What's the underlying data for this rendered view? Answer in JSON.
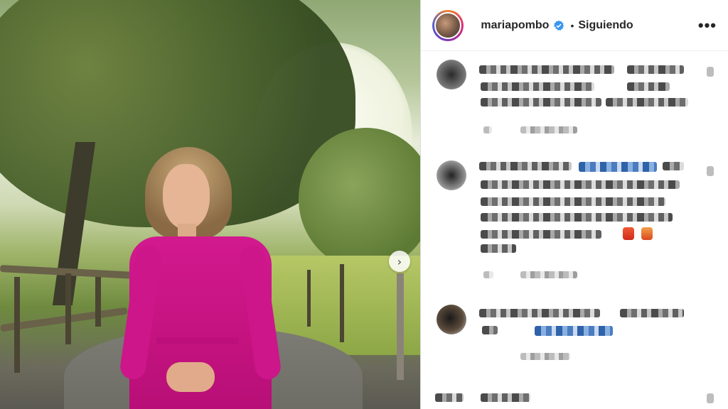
{
  "post": {
    "username": "mariapombo",
    "separator": "•",
    "follow_status": "Siguiendo",
    "more_options": "•••",
    "next_arrow": "›"
  },
  "icons": {
    "verified": "verified-badge-icon",
    "next": "chevron-right-icon",
    "more": "more-options-icon"
  },
  "colors": {
    "verified_blue": "#3897f0",
    "dress_pink": "#cc168a",
    "text_dark": "#262626"
  }
}
